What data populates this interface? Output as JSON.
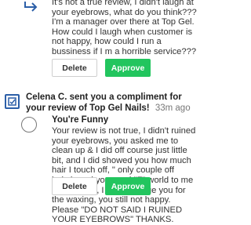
{
  "review1": {
    "text": "It's not a true review, I didn't laugh at your eyebrows, what do you think??? I'm a manager over there at Top Gel. How could I laugh when customer is not happy, how could I run a bussiness if I m a horrible service???",
    "delete_label": "Delete",
    "approve_label": "Approve"
  },
  "notification": {
    "text": "Celena C. sent you a compliment for your review of Top Gel Nails!",
    "time": "33m ago"
  },
  "review2": {
    "reviewer": "You're Funny",
    "text": "Your review is not true, I didn't ruined your eyebrows, you asked me to clean up & I did off course just little bit, and I did showed you how much hair I touch off, \" only couple off hairs), and you used \"F\" world to me many times, I didn't charge you for the waxing, you still not happy. Please \"DO NOT SAID I RUINED YOUR EYEBROWS\" THANKS.",
    "delete_label": "Delete",
    "approve_label": "Approve"
  },
  "colors": {
    "approve": "#22c55e",
    "avatar_border": "#2c5fa8"
  },
  "icons": {
    "reply": "reply-arrow-icon",
    "avatar": "business-avatar-icon",
    "reviewer": "user-avatar-icon"
  }
}
